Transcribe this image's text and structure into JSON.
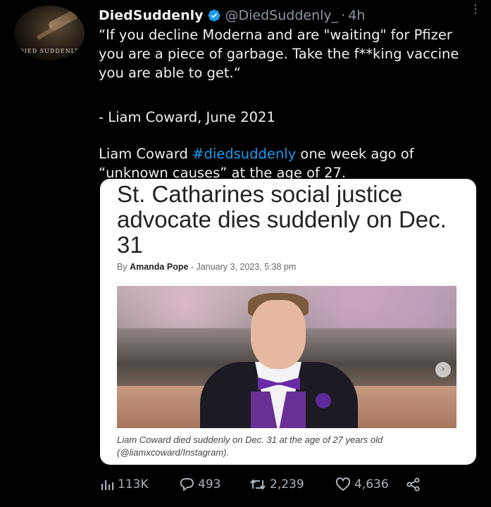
{
  "tweet": {
    "avatar_text": "DIED SUDDENLY",
    "display_name": "DiedSuddenly",
    "handle": "@DiedSuddenly_",
    "separator": "·",
    "time": "4h",
    "text_line1": "“If you decline Moderna and are \"waiting\" for Pfizer you are a piece of garbage. Take the f**king vaccine you are able to get.“",
    "text_line2": "- Liam Coward, June 2021",
    "text_line3_before": "Liam Coward ",
    "hashtag": "#diedsuddenly",
    "text_line3_after": " one week ago of “unknown causes” at the age of 27."
  },
  "article": {
    "headline": "St. Catharines social justice advocate dies suddenly on Dec. 31",
    "byline_prefix": "By ",
    "author": "Amanda Pope",
    "byline_suffix": " - January 3, 2023, 5:38 pm",
    "caption": "Liam Coward died suddenly on Dec. 31 at the age of 27 years old (@liamxcoward/Instagram)."
  },
  "stats": {
    "views": "113K",
    "replies": "493",
    "retweets": "2,239",
    "likes": "4,636"
  },
  "colors": {
    "background": "#000000",
    "text": "#e7e9ea",
    "muted": "#8b98a5",
    "link": "#1d9bf0",
    "verified": "#1d9bf0"
  },
  "icons": [
    "more-icon",
    "verified-badge-icon",
    "views-icon",
    "reply-icon",
    "retweet-icon",
    "like-icon",
    "share-icon",
    "carousel-next-icon"
  ]
}
